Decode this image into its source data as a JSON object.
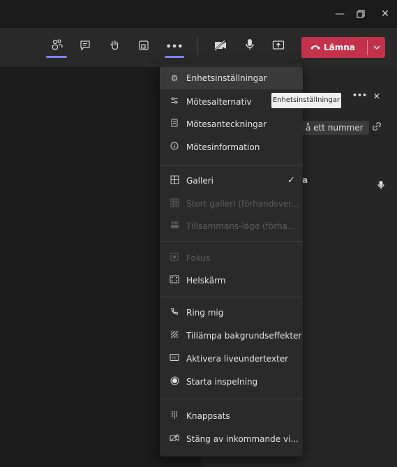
{
  "window": {
    "minimize_icon": "minimize-icon",
    "maximize_icon": "maximize-icon",
    "close_icon": "close-icon"
  },
  "toolbar": {
    "icons": [
      "people-icon",
      "chat-icon",
      "raise-hand-icon",
      "rooms-icon",
      "more-icon",
      "camera-off-icon",
      "mic-icon",
      "share-icon"
    ],
    "leave_label": "Lämna",
    "leave_color": "#c4314b",
    "accent_color": "#7f85f5"
  },
  "panel": {
    "phone_text": "å ett nummer",
    "participant_initial": "a",
    "more_icon_text": "•••",
    "close_icon_text": "✕"
  },
  "tooltip": {
    "text": "Enhetsinställningar"
  },
  "menu": {
    "items": [
      {
        "label": "Enhetsinställningar",
        "icon": "gear-icon"
      },
      {
        "label": "Mötesalternativ",
        "icon": "sliders-icon"
      },
      {
        "label": "Mötesanteckningar",
        "icon": "notes-icon"
      },
      {
        "label": "Mötesinformation",
        "icon": "info-icon"
      },
      {
        "label": "Galleri",
        "icon": "grid-icon"
      },
      {
        "label": "Stort galleri (förhandsver...",
        "icon": "large-grid-icon"
      },
      {
        "label": "Tillsammans-läge (förha...",
        "icon": "together-icon"
      },
      {
        "label": "Fokus",
        "icon": "focus-icon"
      },
      {
        "label": "Helskärm",
        "icon": "fullscreen-icon"
      },
      {
        "label": "Ring mig",
        "icon": "phone-icon"
      },
      {
        "label": "Tillämpa bakgrundseffekter",
        "icon": "background-effects-icon"
      },
      {
        "label": "Aktivera liveundertexter",
        "icon": "captions-icon"
      },
      {
        "label": "Starta inspelning",
        "icon": "record-icon"
      },
      {
        "label": "Knappsats",
        "icon": "keypad-icon"
      },
      {
        "label": "Stäng av inkommande vi...",
        "icon": "video-off-icon"
      }
    ]
  }
}
